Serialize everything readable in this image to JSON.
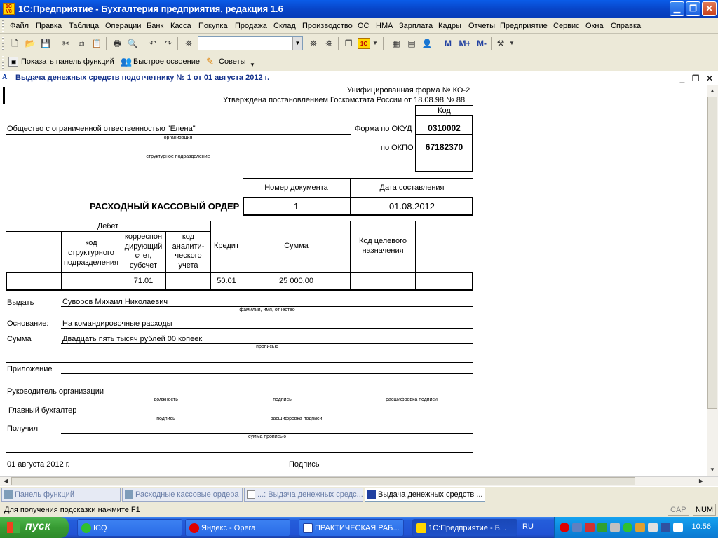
{
  "app": {
    "title": "1С:Предприятие - Бухгалтерия предприятия, редакция 1.6",
    "icon_text_1": "1C",
    "icon_text_2": "V8"
  },
  "menu": [
    "Файл",
    "Правка",
    "Таблица",
    "Операции",
    "Банк",
    "Касса",
    "Покупка",
    "Продажа",
    "Склад",
    "Производство",
    "ОС",
    "НМА",
    "Зарплата",
    "Кадры",
    "Отчеты",
    "Предприятие",
    "Сервис",
    "Окна",
    "Справка"
  ],
  "toolbar2": {
    "show_panel": "Показать панель функций",
    "quick_learn": "Быстрое освоение",
    "tips": "Советы"
  },
  "toolbar1": {
    "m": "M",
    "mplus": "M+",
    "mminus": "M-"
  },
  "doc": {
    "title": "Выдача денежных средств подотчетнику № 1 от 01 августа 2012 г."
  },
  "form": {
    "unified": "Унифицированная форма № КО-2",
    "approved": "Утверждена постановлением Госкомстата России от 18.08.98 № 88",
    "code_header": "Код",
    "okud_label": "Форма по ОКУД",
    "okud": "0310002",
    "okpo_label": "по ОКПО",
    "okpo": "67182370",
    "org_name": "Общество с ограниченной отвественностью \"Елена\"",
    "org_caption": "организация",
    "dept_caption": "структурное подразделение",
    "docnum_header": "Номер документа",
    "date_header": "Дата составления",
    "order_title": "РАСХОДНЫЙ КАССОВЫЙ ОРДЕР",
    "doc_number": "1",
    "doc_date": "01.08.2012",
    "debit": "Дебет",
    "col_dept_code": "код структурного подразделения",
    "col_corr_1": "корреспон",
    "col_corr_2": "дирующий",
    "col_corr_3": "счет,",
    "col_corr_4": "субсчет",
    "col_anal_1": "код",
    "col_anal_2": "аналити-",
    "col_anal_3": "ческого",
    "col_anal_4": "учета",
    "col_credit": "Кредит",
    "col_sum": "Сумма",
    "col_target": "Код целевого назначения",
    "row_corr": "71.01",
    "row_credit": "50.01",
    "row_sum": "25 000,00",
    "issue_label": "Выдать",
    "issue_to": "Суворов Михаил Николаевич",
    "fio_caption": "фамилия, имя, отчество",
    "basis_label": "Основание:",
    "basis": "На командировочные расходы",
    "sum_label": "Сумма",
    "sum_words": "Двадцать пять тысяч рублей 00 копеек",
    "words_caption": "прописью",
    "appendix_label": "Приложение",
    "head_label": "Руководитель организации",
    "position_caption": "должность",
    "signature_caption": "подпись",
    "decode_caption": "расшифровка подписи",
    "chief_label": "Главный бухгалтер",
    "received_label": "Получил",
    "sum_words_caption": "сумма прописью",
    "footer_date": "01 августа 2012 г.",
    "sign_label": "Подпись"
  },
  "window_tabs": [
    "Панель функций",
    "Расходные кассовые ордера",
    "...: Выдача денежных средс...",
    "Выдача денежных средств ..."
  ],
  "status": {
    "hint": "Для получения подсказки нажмите F1",
    "cap": "CAP",
    "num": "NUM"
  },
  "taskbar": {
    "start": "пуск",
    "items": [
      "ICQ",
      "Яндекс - Opera",
      "ПРАКТИЧЕСКАЯ РАБ...",
      "1С:Предприятие - Б..."
    ],
    "lang": "RU",
    "clock": "10:56"
  }
}
